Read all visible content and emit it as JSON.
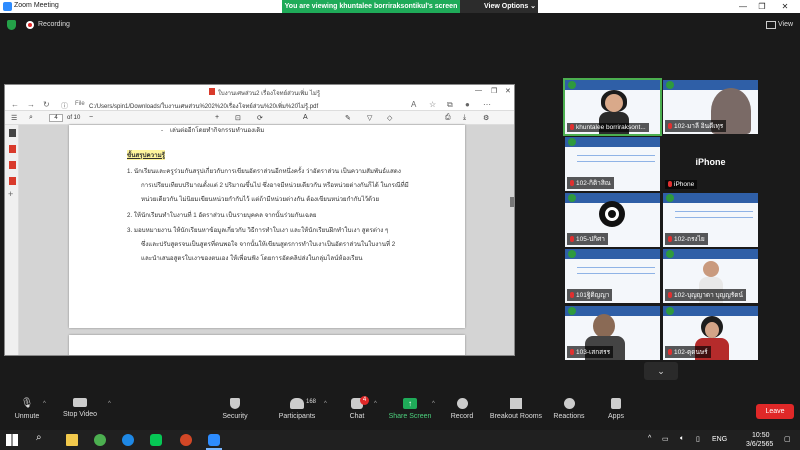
{
  "window": {
    "title": "Zoom Meeting",
    "minimize": "—",
    "maximize": "❐",
    "close": "✕"
  },
  "share_banner": {
    "text": "You are viewing khuntalee borriraksontikul's screen",
    "view_options": "View Options"
  },
  "meeting_bar": {
    "recording_label": "Recording",
    "view_label": "View"
  },
  "browser": {
    "title": "ใบงานเศษส่วน2 เรื่องโจทย์ส่วนเพิ่ม ไม่รู้",
    "file_label": "File",
    "address": "C:/Users/spin1/Downloads/ใบงานเศษส่วน%202%20เรื่องโจทย์ส่วน%20เพิ่ม%20ไม่รู้.pdf",
    "page_input": "4",
    "page_total": "of 10"
  },
  "pdf": {
    "bullet_line": "เล่นต่ออีกโดยทำกิจกรรมทำนองเดิม",
    "heading": "ขั้นสรุปความรู้",
    "lines": [
      "1.   นักเรียนและครูร่วมกันสรุปเกี่ยวกับการเขียนอัตราส่วนอีกหนึ่งครั้ง ว่าอัตราส่วน เป็นความสัมพันธ์แสดง",
      "การเปรียบเทียบปริมาณตั้งแต่ 2 ปริมาณขึ้นไป ซึ่งอาจมีหน่วยเดียวกัน หรือหน่วยต่างกันก็ได้ ในกรณีที่มี",
      "หน่วยเดียวกัน ไม่นิยมเขียนหน่วยกำกับไว้ แต่ถ้ามีหน่วยต่างกัน ต้องเขียนหน่วยกำกับไว้ด้วย",
      "2.   ให้นักเรียนทำใบงานที่ 1 อัตราส่วน เป็นรายบุคคล จากนั้นร่วมกันเฉลย",
      "3.   มอบหมายงาน  ให้นักเรียนหาข้อมูลเกี่ยวกับ วิธีการทำใบเงา และให้นักเรียนฝึกทำใบเงา สูตรต่าง ๆ",
      "ซึ่งและปรับสูตรจนเป็นสูตรที่ตนพอใจ  จากนั้นให้เขียนสูตรการทำใบเงาเป็นอัตราส่วนในใบงานที่ 2",
      "และนำเสนอสูตรใบเงาของตนเอง ให้เพื่อนฟัง โดยการอัดคลิปส่งในกลุ่มไลน์ห้องเรียน"
    ]
  },
  "participants": [
    {
      "name": "khuntalee borriraksont..."
    },
    {
      "name": "102-มาลี อินดีเทุร"
    },
    {
      "name": "102-กิติาสิณ"
    },
    {
      "name": "iPhone",
      "center_label": "iPhone"
    },
    {
      "name": "105-ปกิศา"
    },
    {
      "name": "102-ถรงไย"
    },
    {
      "name": "101ฐิติญญา"
    },
    {
      "name": "102-บุญญาดา บุญญรัตน์"
    },
    {
      "name": "103-เสกสรร"
    },
    {
      "name": "102-ตุดนษร์"
    }
  ],
  "toolbar": {
    "unmute": "Unmute",
    "stop_video": "Stop Video",
    "security": "Security",
    "participants": "Participants",
    "participants_count": "168",
    "chat": "Chat",
    "chat_badge": "4",
    "share_screen": "Share Screen",
    "record": "Record",
    "breakout": "Breakout Rooms",
    "reactions": "Reactions",
    "apps": "Apps",
    "leave": "Leave"
  },
  "taskbar": {
    "lang": "ENG",
    "time": "10:50",
    "date": "3/6/2565"
  },
  "colors": {
    "share_green": "#1fab59",
    "leave_red": "#e02828",
    "zoom_blue": "#2d8cff",
    "active_border": "#4caf50"
  }
}
